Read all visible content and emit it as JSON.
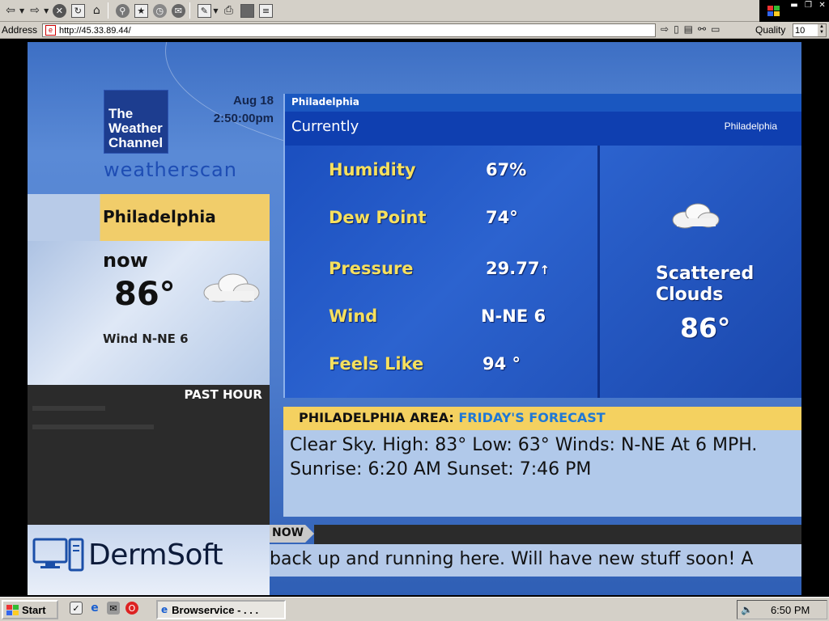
{
  "browser": {
    "address_label": "Address",
    "url": "http://45.33.89.44/",
    "quality_label": "Quality",
    "quality_value": "10"
  },
  "weather": {
    "logo_text": "The Weather Channel",
    "brand": "weatherscan",
    "date": "Aug 18",
    "time": "2:50:00pm",
    "now_panel": {
      "city": "Philadelphia",
      "now_label": "now",
      "temp": "86°",
      "wind": "Wind N-NE 6"
    },
    "past_hour": {
      "title": "PAST HOUR"
    },
    "conditions": {
      "city_small": "Philadelphia",
      "header": "Currently",
      "city_right": "Philadelphia",
      "humidity_label": "Humidity",
      "humidity_value": "67%",
      "dewpoint_label": "Dew Point",
      "dewpoint_value": "74°",
      "pressure_label": "Pressure",
      "pressure_value": "29.77",
      "pressure_trend": "↑",
      "wind_label": "Wind",
      "wind_value": "N-NE 6",
      "feelslike_label": "Feels Like",
      "feelslike_value": "94 °",
      "description": "Scattered Clouds",
      "temp": "86°"
    },
    "forecast": {
      "area": "PHILADELPHIA AREA:",
      "day": "FRIDAY'S FORECAST",
      "text": "Clear Sky. High: 83° Low: 63° Winds: N-NE At 6 MPH. Sunrise: 6:20 AM Sunset: 7:46 PM"
    },
    "bottom": {
      "sponsor": "DermSoft",
      "now_tag": "NOW",
      "ticker": "back up and running here. Will have new stuff soon! A"
    }
  },
  "taskbar": {
    "start_label": "Start",
    "task_label": "Browservice  -  . . .",
    "clock": "6:50 PM"
  },
  "icons": {
    "toolbar": [
      "back-icon",
      "forward-icon",
      "stop-icon",
      "refresh-icon",
      "home-icon",
      "search-icon",
      "favorites-icon",
      "history-icon",
      "mail-icon",
      "edit-icon",
      "print-icon",
      "discuss-icon",
      "page-icon"
    ]
  },
  "colors": {
    "highlight_yellow": "#f4d160",
    "condition_label": "#f6e05e",
    "forecast_day": "#1f78d6",
    "header_blue": "#0f3fb0"
  }
}
